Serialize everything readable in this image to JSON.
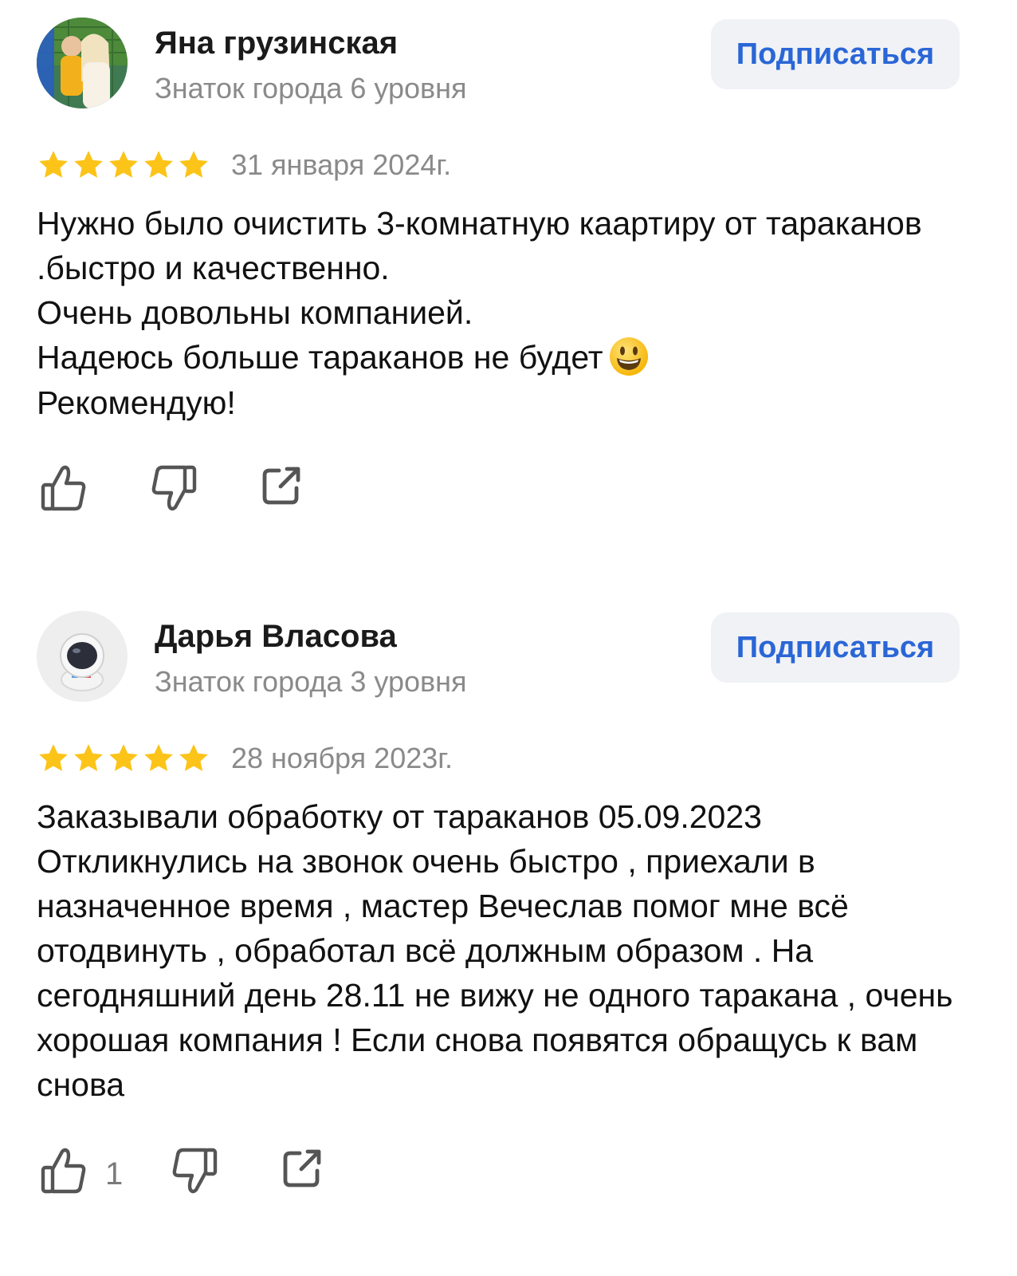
{
  "reviews": [
    {
      "author": "Яна грузинская",
      "level": "Знаток города 6 уровня",
      "subscribe_label": "Подписаться",
      "rating": 5,
      "date": "31 января 2024г.",
      "text": "Нужно было очистить 3-комнатную каартиру от тараканов .быстро и качественно.\nОчень довольны компанией.\nНадеюсь больше тараканов не будет",
      "text_tail": "Рекомендую!",
      "emoji": "smiley-emoji",
      "likes": "",
      "avatar": "photo-avatar"
    },
    {
      "author": "Дарья Власова",
      "level": "Знаток города 3 уровня",
      "subscribe_label": "Подписаться",
      "rating": 5,
      "date": "28 ноября 2023г.",
      "text": "Заказывали обработку от тараканов 05.09.2023\nОткликнулись на звонок очень быстро , приехали в назначенное время , мастер Вечеслав помог мне всё отодвинуть , обработал всё должным образом . На сегодняшний день 28.11 не вижу не одного таракана , очень хорошая компания ! Если снова появятся обращусь к вам снова",
      "likes": "1",
      "avatar": "astronaut-avatar"
    }
  ],
  "icons": {
    "like": "thumbs-up-icon",
    "dislike": "thumbs-down-icon",
    "share": "share-icon",
    "star": "star-icon"
  },
  "colors": {
    "star": "#fcc419",
    "accent": "#2a66d6",
    "button_bg": "#f0f2f6",
    "muted": "#8a8a8a",
    "icon": "#555555"
  }
}
